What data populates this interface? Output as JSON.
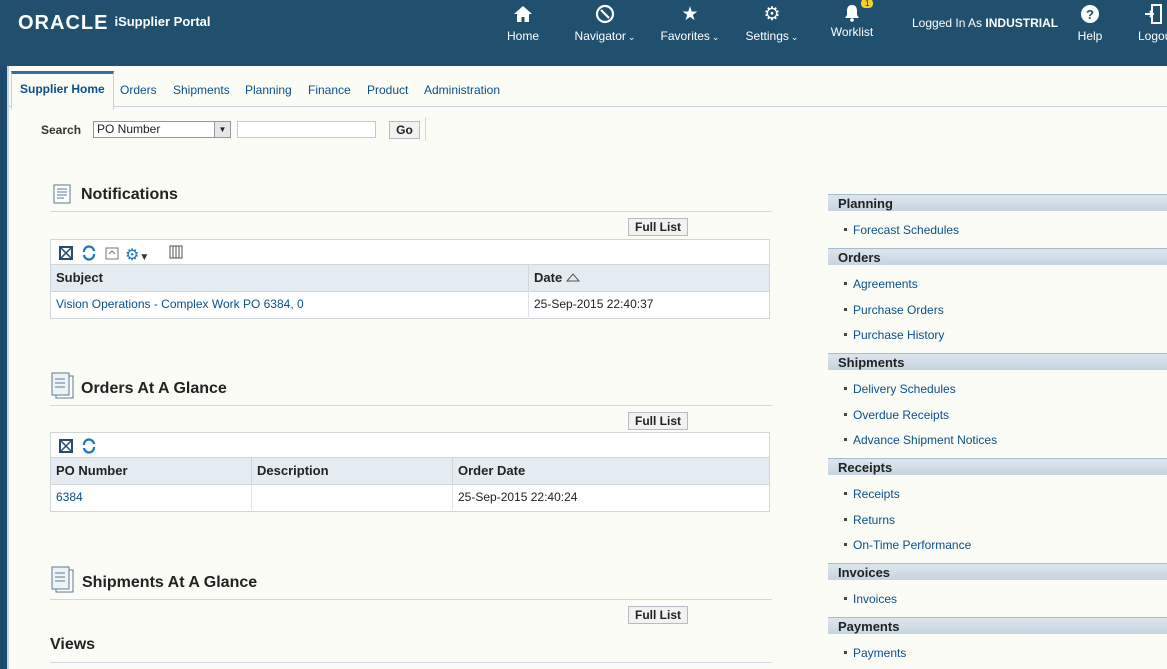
{
  "header": {
    "brand": "ORACLE",
    "app_name": "iSupplier Portal",
    "nav": [
      {
        "label": "Home",
        "icon": "home-icon"
      },
      {
        "label": "Navigator",
        "icon": "compass-icon"
      },
      {
        "label": "Favorites",
        "icon": "star-icon"
      },
      {
        "label": "Settings",
        "icon": "gear-icon"
      },
      {
        "label": "Worklist",
        "icon": "bell-icon",
        "badge": "1"
      }
    ],
    "logged_in_prefix": "Logged In As",
    "user": "INDUSTRIAL",
    "help": "Help",
    "logout": "Logout"
  },
  "tabs": [
    "Supplier Home",
    "Orders",
    "Shipments",
    "Planning",
    "Finance",
    "Product",
    "Administration"
  ],
  "search": {
    "label": "Search",
    "selected": "PO Number",
    "value": "",
    "go_label": "Go"
  },
  "notifications": {
    "title": "Notifications",
    "full_list": "Full List",
    "columns": [
      "Subject",
      "Date"
    ],
    "rows": [
      {
        "subject": "Vision Operations - Complex Work PO 6384, 0",
        "date": "25-Sep-2015 22:40:37"
      }
    ]
  },
  "orders": {
    "title": "Orders At A Glance",
    "full_list": "Full List",
    "columns": [
      "PO Number",
      "Description",
      "Order Date"
    ],
    "rows": [
      {
        "po": "6384",
        "description": "",
        "date": "25-Sep-2015 22:40:24"
      }
    ]
  },
  "shipments": {
    "title": "Shipments At A Glance",
    "full_list": "Full List"
  },
  "views_title": "Views",
  "sidebar": [
    {
      "heading": "Planning",
      "links": [
        "Forecast Schedules"
      ]
    },
    {
      "heading": "Orders",
      "links": [
        "Agreements",
        "Purchase Orders",
        "Purchase History"
      ]
    },
    {
      "heading": "Shipments",
      "links": [
        "Delivery Schedules",
        "Overdue Receipts",
        "Advance Shipment Notices"
      ]
    },
    {
      "heading": "Receipts",
      "links": [
        "Receipts",
        "Returns",
        "On-Time Performance"
      ]
    },
    {
      "heading": "Invoices",
      "links": [
        "Invoices"
      ]
    },
    {
      "heading": "Payments",
      "links": [
        "Payments"
      ]
    }
  ],
  "colors": {
    "header_bg": "#21506f",
    "link": "#0a4f8a",
    "page_bg": "#fcfcf6",
    "table_header_bg": "#e4ecf1"
  }
}
